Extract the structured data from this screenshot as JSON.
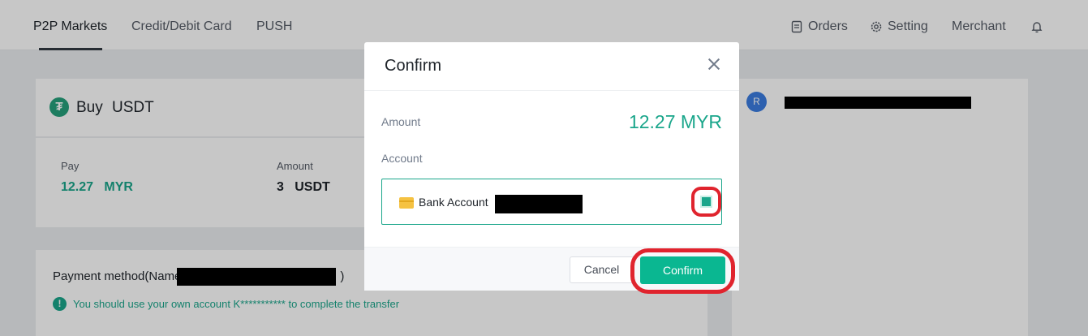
{
  "nav": {
    "tabs": [
      {
        "label": "P2P Markets"
      },
      {
        "label": "Credit/Debit Card"
      },
      {
        "label": "PUSH"
      }
    ],
    "right": {
      "orders": "Orders",
      "setting": "Setting",
      "merchant": "Merchant"
    }
  },
  "order": {
    "title_action": "Buy",
    "title_asset": "USDT",
    "pay_label": "Pay",
    "pay_value": "12.27",
    "pay_currency": "MYR",
    "amount_label": "Amount",
    "amount_value": "3",
    "amount_currency": "USDT"
  },
  "payment": {
    "method_prefix": "Payment method(Name",
    "method_suffix": ")",
    "notice": "You should use your own account K*********** to complete the transfer"
  },
  "merchant": {
    "avatar_initial": "R"
  },
  "modal": {
    "title": "Confirm",
    "amount_label": "Amount",
    "amount_value": "12.27 MYR",
    "account_label": "Account",
    "account_option": "Bank Account",
    "cancel_label": "Cancel",
    "confirm_label": "Confirm"
  },
  "colors": {
    "accent": "#1aa68b",
    "confirm_button": "#0ab791",
    "highlight_ring": "#e0242e"
  }
}
